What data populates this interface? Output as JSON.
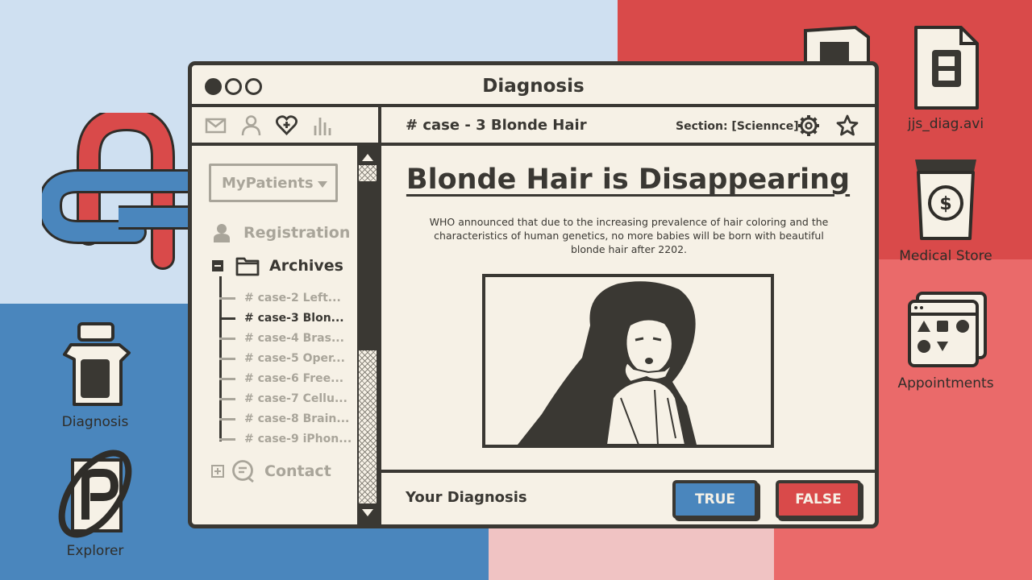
{
  "window": {
    "title": "Diagnosis"
  },
  "toolbar": {
    "icons": [
      "mail-icon",
      "user-icon",
      "heart-plus-icon",
      "bar-chart-icon"
    ]
  },
  "sidebar": {
    "dropdown": "MyPatients",
    "registration": "Registration",
    "archives": "Archives",
    "contact": "Contact",
    "cases": [
      "# case-2 Left...",
      "# case-3 Blon...",
      "# case-4 Bras...",
      "# case-5 Oper...",
      "# case-6 Free...",
      "# case-7 Cellu...",
      "# case-8 Brain...",
      "# case-9 iPhon..."
    ],
    "active_case_index": 1
  },
  "main": {
    "case_title": "# case - 3 Blonde Hair",
    "section": "Section: [Sciennce]",
    "headline": "Blonde Hair is Disappearing",
    "body": "WHO announced that due to the increasing prevalence of hair coloring and the characteristics of human genetics, no more babies will be born with beautiful blonde hair after 2202.",
    "your_diagnosis": "Your Diagnosis",
    "true_label": "TRUE",
    "false_label": "FALSE"
  },
  "desktop": {
    "diagnosis": "Diagnosis",
    "explorer": "Explorer",
    "jjs_diag": "jjs_diag.avi",
    "medical_store": "Medical Store",
    "appointments": "Appointments"
  },
  "colors": {
    "ink": "#3a3833",
    "paper": "#f6f1e6",
    "blue": "#4a86bd",
    "red": "#d94a4a",
    "light_blue": "#cfe0f1",
    "pink": "#f0c3c3",
    "coral": "#ea6a6a",
    "muted": "#a9a59a"
  }
}
